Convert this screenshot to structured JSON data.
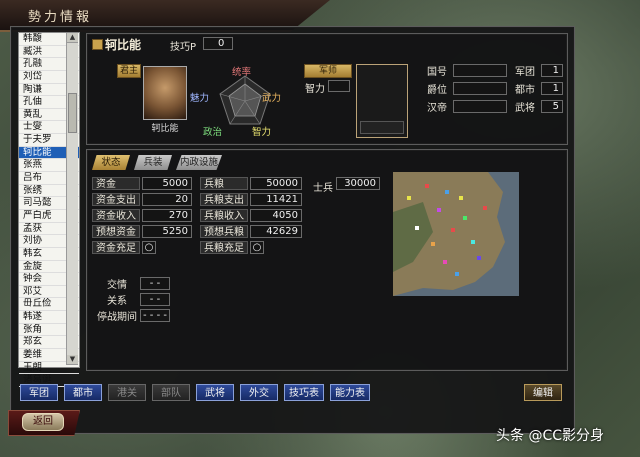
{
  "window": {
    "title": "勢力情報"
  },
  "officers": [
    "韩馥",
    "臧洪",
    "孔融",
    "刘岱",
    "陶谦",
    "孔伷",
    "黄乱",
    "士燮",
    "于夫罗",
    "轲比能",
    "张燕",
    "吕布",
    "张绣",
    "司马懿",
    "严白虎",
    "孟获",
    "刘协",
    "韩玄",
    "金旋",
    "钟会",
    "邓艾",
    "毌丘俭",
    "韩遂",
    "张角",
    "郑玄",
    "姜维",
    "王朗",
    "诸葛诞"
  ],
  "selected_index": 9,
  "header": {
    "ruler_name": "轲比能",
    "skill_p_label": "技巧P",
    "skill_p_value": "0"
  },
  "ruler": {
    "role_label": "君主",
    "name": "轲比能",
    "stats_labels": {
      "top": "统率",
      "left": "魅力",
      "right": "武力",
      "bottom_left": "政治",
      "bottom_right": "智力"
    }
  },
  "advisor": {
    "role_label": "军师",
    "intel_label": "智力",
    "intel_value": ""
  },
  "info": {
    "rows": [
      {
        "label": "国号",
        "value": "",
        "label2": "军团",
        "value2": "1"
      },
      {
        "label": "爵位",
        "value": "",
        "label2": "都市",
        "value2": "1"
      },
      {
        "label": "汉帝",
        "value": "",
        "label2": "武将",
        "value2": "5"
      }
    ]
  },
  "tabs": [
    "状态",
    "兵装",
    "内政设施"
  ],
  "finance": [
    {
      "label": "资金",
      "value": "5000"
    },
    {
      "label": "资金支出",
      "value": "20"
    },
    {
      "label": "资金收入",
      "value": "270"
    },
    {
      "label": "预想资金",
      "value": "5250"
    },
    {
      "label": "资金充足",
      "value": "○"
    }
  ],
  "food": [
    {
      "label": "兵粮",
      "value": "50000"
    },
    {
      "label": "兵粮支出",
      "value": "11421"
    },
    {
      "label": "兵粮收入",
      "value": "4050"
    },
    {
      "label": "预想兵粮",
      "value": "42629"
    },
    {
      "label": "兵粮充足",
      "value": "○"
    }
  ],
  "troops": {
    "label": "士兵",
    "value": "30000"
  },
  "diplomacy": [
    {
      "label": "交情",
      "value": "- -"
    },
    {
      "label": "关系",
      "value": "- -"
    },
    {
      "label": "停战期间",
      "value": "- - - -"
    }
  ],
  "bottom_buttons": [
    {
      "label": "军团",
      "enabled": true
    },
    {
      "label": "都市",
      "enabled": true
    },
    {
      "label": "港关",
      "enabled": false
    },
    {
      "label": "部队",
      "enabled": false
    },
    {
      "label": "武将",
      "enabled": true
    },
    {
      "label": "外交",
      "enabled": true
    },
    {
      "label": "技巧表",
      "enabled": true
    },
    {
      "label": "能力表",
      "enabled": true
    }
  ],
  "edit_label": "编辑",
  "back_label": "返回",
  "watermark": "头条 @CC影分身",
  "colors": {
    "accent_gold": "#c9a24d",
    "selected_blue": "#1f5fb6",
    "button_blue": "#23408a"
  }
}
